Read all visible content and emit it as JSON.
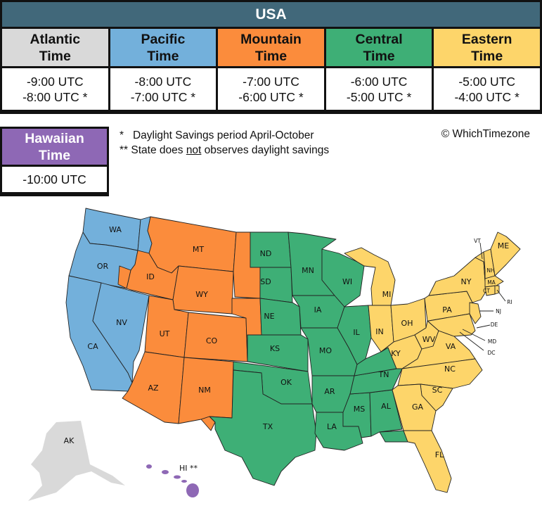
{
  "title": "USA",
  "colors": {
    "header": "#41687a",
    "atlantic": "#d9d9d9",
    "pacific": "#73b0db",
    "mountain": "#fb8c3c",
    "central": "#3eaf76",
    "eastern": "#fdd56a",
    "hawaiian": "#8e68b5"
  },
  "zones": [
    {
      "name_line1": "Atlantic",
      "name_line2": "Time",
      "standard": "-9:00 UTC",
      "daylight": "-8:00 UTC *",
      "color": "#d9d9d9",
      "text_color": "#111111"
    },
    {
      "name_line1": "Pacific",
      "name_line2": "Time",
      "standard": "-8:00 UTC",
      "daylight": "-7:00 UTC *",
      "color": "#73b0db",
      "text_color": "#111111"
    },
    {
      "name_line1": "Mountain",
      "name_line2": "Time",
      "standard": "-7:00 UTC",
      "daylight": "-6:00 UTC *",
      "color": "#fb8c3c",
      "text_color": "#111111"
    },
    {
      "name_line1": "Central",
      "name_line2": "Time",
      "standard": "-6:00 UTC",
      "daylight": "-5:00 UTC *",
      "color": "#3eaf76",
      "text_color": "#111111"
    },
    {
      "name_line1": "Eastern",
      "name_line2": "Time",
      "standard": "-5:00 UTC",
      "daylight": "-4:00 UTC *",
      "color": "#fdd56a",
      "text_color": "#111111"
    }
  ],
  "hawaiian": {
    "name_line1": "Hawaiian",
    "name_line2": "Time",
    "offset": "-10:00 UTC"
  },
  "notes": {
    "note1_marker": "*",
    "note1_text": "Daylight Savings period April-October",
    "note2_marker": "**",
    "note2_pre": "State does ",
    "note2_emph": "not",
    "note2_post": " observes daylight savings"
  },
  "copyright": "© WhichTimezone",
  "map": {
    "state_labels": {
      "WA": "WA",
      "OR": "OR",
      "CA": "CA",
      "NV": "NV",
      "ID": "ID",
      "MT": "MT",
      "WY": "WY",
      "UT": "UT",
      "CO": "CO",
      "AZ": "AZ",
      "NM": "NM",
      "ND": "ND",
      "SD": "SD",
      "NE": "NE",
      "KS": "KS",
      "OK": "OK",
      "TX": "TX",
      "MN": "MN",
      "IA": "IA",
      "MO": "MO",
      "AR": "AR",
      "LA": "LA",
      "WI": "WI",
      "IL": "IL",
      "MS": "MS",
      "AL": "AL",
      "TN": "TN",
      "MI": "MI",
      "IN": "IN",
      "OH": "OH",
      "KY": "KY",
      "WV": "WV",
      "VA": "VA",
      "NC": "NC",
      "SC": "SC",
      "GA": "GA",
      "FL": "FL",
      "PA": "PA",
      "NY": "NY",
      "VT": "VT",
      "NH": "NH",
      "ME": "ME",
      "MA": "MA",
      "CT": "CT",
      "RI": "RI",
      "NJ": "NJ",
      "DE": "DE",
      "MD": "MD",
      "DC": "DC",
      "AK": "AK",
      "HI": "HI **"
    }
  }
}
